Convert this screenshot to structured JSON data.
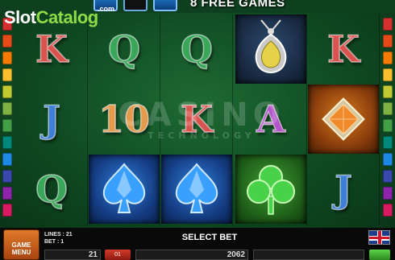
{
  "header": {
    "free_games": "8 FREE GAMES"
  },
  "logo": {
    "slot": "Slot",
    "catalog": "Catalog",
    "com": ".com"
  },
  "reels": [
    [
      {
        "symbol": "K",
        "color": "#d9534f"
      },
      {
        "symbol": "J",
        "color": "#3f7fd6"
      },
      {
        "symbol": "Q",
        "color": "#3aa65a"
      }
    ],
    [
      {
        "symbol": "Q",
        "color": "#3aa65a"
      },
      {
        "symbol": "10",
        "color": "#e39a4a"
      },
      {
        "symbol": "spade-gem",
        "color": "#39a0ff"
      }
    ],
    [
      {
        "symbol": "Q",
        "color": "#3aa65a"
      },
      {
        "symbol": "K",
        "color": "#d9534f"
      },
      {
        "symbol": "spade-gem",
        "color": "#39a0ff"
      }
    ],
    [
      {
        "symbol": "amulet-gem",
        "color": "#e5d24a"
      },
      {
        "symbol": "A",
        "color": "#b356c9"
      },
      {
        "symbol": "clover-gem",
        "color": "#4ad14a"
      }
    ],
    [
      {
        "symbol": "K",
        "color": "#d9534f"
      },
      {
        "symbol": "diamond-gem",
        "color": "#f08a2a"
      },
      {
        "symbol": "J",
        "color": "#3f7fd6"
      }
    ]
  ],
  "watermark": {
    "main": "CASINO",
    "sub": "TECHNOLOGY"
  },
  "panel": {
    "menu_label": "GAME MENU",
    "lines_label": "LINES : 21",
    "bet_label": "BET : 1",
    "select_bet": "SELECT BET",
    "lines_value": "21",
    "credit_btn": "01",
    "credit_value": "2062"
  },
  "side_colors": [
    "#d32f2f",
    "#e64a19",
    "#f57c00",
    "#fbc02d",
    "#c0ca33",
    "#7cb342",
    "#43a047",
    "#00897b",
    "#1e88e5",
    "#3949ab",
    "#8e24aa",
    "#d81b60"
  ]
}
